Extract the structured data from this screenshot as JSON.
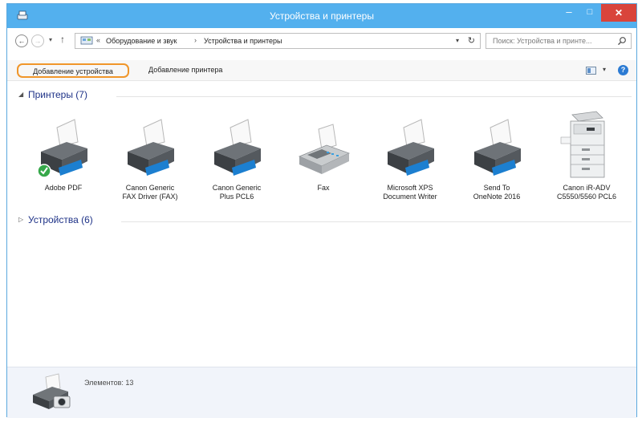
{
  "window": {
    "title": "Устройства и принтеры",
    "app_icon": "devices-printers-icon",
    "controls": {
      "minimize": "–",
      "maximize": "□",
      "close": "✕"
    },
    "accent_color": "#53b0ee",
    "close_color": "#d9443b"
  },
  "navigation": {
    "back": "←",
    "forward": "→",
    "recent": "▾",
    "up": "↑",
    "address_sep": "«",
    "breadcrumbs": [
      "Оборудование и звук",
      "Устройства и принтеры"
    ],
    "crumb_sep": "›",
    "address_dropdown": "▾",
    "refresh": "↻"
  },
  "search": {
    "placeholder": "Поиск: Устройства и принте..."
  },
  "toolbar": {
    "add_device": "Добавление устройства",
    "add_printer": "Добавление принтера",
    "view_dropdown": "▾",
    "help": "?",
    "highlight_color": "#f0962a"
  },
  "groups": {
    "printers": {
      "toggle": "◢",
      "title": "Принтеры (7)",
      "items": [
        {
          "label": "Adobe PDF",
          "icon": "printer-icon",
          "default": true
        },
        {
          "label": "Canon Generic\nFAX Driver (FAX)",
          "icon": "printer-icon"
        },
        {
          "label": "Canon Generic\nPlus PCL6",
          "icon": "printer-icon"
        },
        {
          "label": "Fax",
          "icon": "fax-icon"
        },
        {
          "label": "Microsoft XPS\nDocument Writer",
          "icon": "printer-icon"
        },
        {
          "label": "Send To\nOneNote 2016",
          "icon": "printer-icon"
        },
        {
          "label": "Canon iR-ADV\nC5550/5560 PCL6",
          "icon": "copier-icon"
        }
      ]
    },
    "devices": {
      "toggle": "▷",
      "title": "Устройства (6)"
    }
  },
  "details": {
    "icon": "devices-printers-icon",
    "text": "Элементов: 13"
  }
}
